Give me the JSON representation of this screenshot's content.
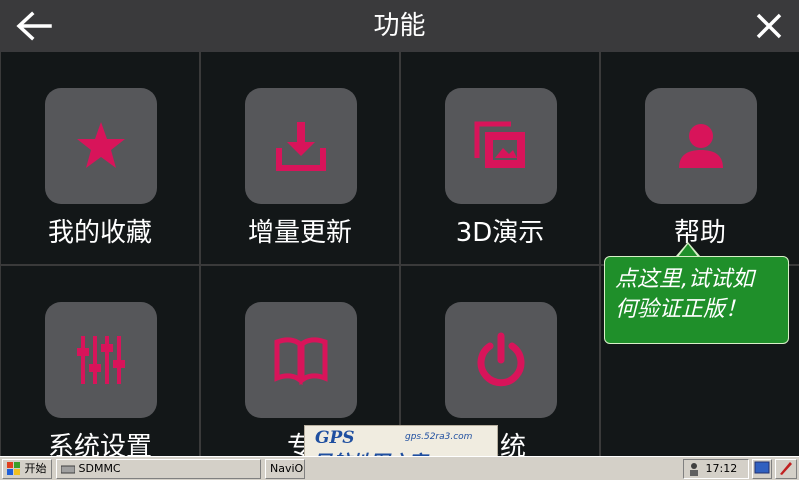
{
  "header": {
    "title": "功能",
    "back_icon": "arrow-left-icon",
    "close_icon": "close-icon"
  },
  "colors": {
    "accent": "#d8145a",
    "tile": "#56575a",
    "cell_bg": "#131718",
    "header_bg": "#3a3a3c",
    "tooltip_bg": "#1f8f2a"
  },
  "grid": {
    "items": [
      {
        "label": "我的收藏",
        "icon": "star-icon"
      },
      {
        "label": "增量更新",
        "icon": "download-icon"
      },
      {
        "label": "3D演示",
        "icon": "gallery-icon"
      },
      {
        "label": "帮助",
        "icon": "person-icon"
      },
      {
        "label": "系统设置",
        "icon": "sliders-icon"
      },
      {
        "label": "专",
        "icon": "book-icon"
      },
      {
        "label": "系统",
        "icon": "power-icon"
      }
    ]
  },
  "tooltip": {
    "line1": "点这里,试试如",
    "line2": "何验证正版！"
  },
  "taskbar": {
    "start": "开始",
    "sdmmc": "SDMMC",
    "navi": "NaviO",
    "time": "17:12"
  },
  "watermark": {
    "gps": "GPS",
    "url": "gps.52ra3.com",
    "text": "导航地图之家"
  }
}
